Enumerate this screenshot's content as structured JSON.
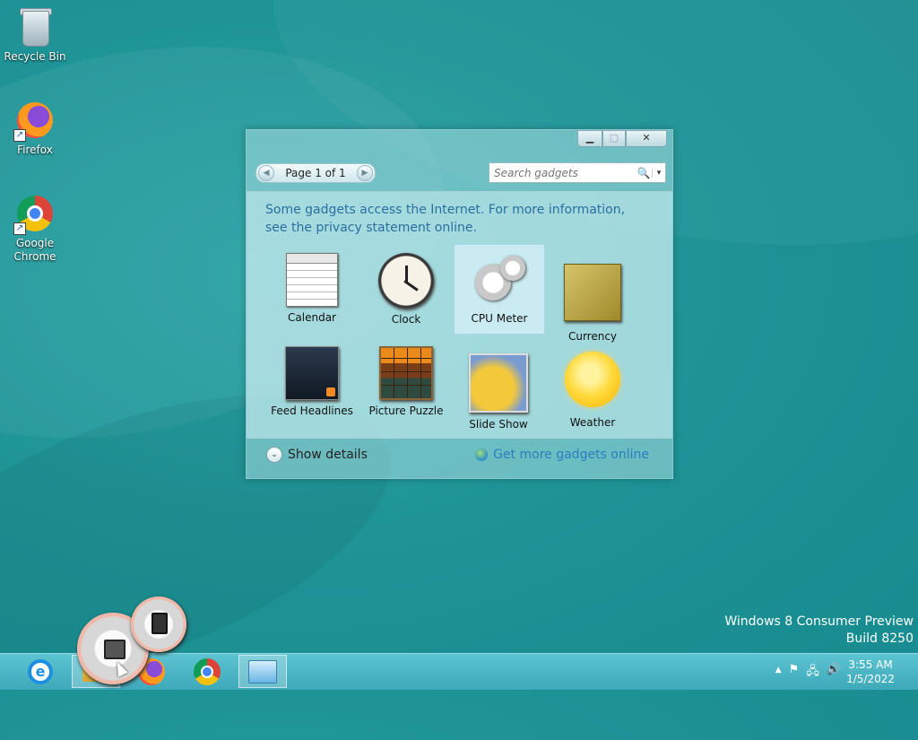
{
  "desktop": {
    "icons": [
      {
        "label": "Recycle Bin",
        "icon": "recycle-bin-icon"
      },
      {
        "label": "Firefox",
        "icon": "firefox-icon"
      },
      {
        "label": "Google Chrome",
        "icon": "chrome-icon"
      }
    ],
    "watermark": {
      "line1": "Windows 8 Consumer Preview",
      "line2": "Build 8250"
    }
  },
  "gadget_window": {
    "caption_buttons": {
      "minimize": "▁",
      "maximize": "▢",
      "close": "✕"
    },
    "pager": {
      "prev": "◀",
      "label": "Page 1 of 1",
      "next": "▶"
    },
    "search": {
      "placeholder": "Search gadgets",
      "icon": "🔍",
      "dropdown": "▾"
    },
    "notice": "Some gadgets access the Internet.  For more information, see the privacy statement online.",
    "gadgets": [
      {
        "label": "Calendar",
        "icon": "calendar-icon"
      },
      {
        "label": "Clock",
        "icon": "clock-icon"
      },
      {
        "label": "CPU Meter",
        "icon": "cpu-meter-icon",
        "selected": true
      },
      {
        "label": "Currency",
        "icon": "currency-icon"
      },
      {
        "label": "Feed Headlines",
        "icon": "feed-headlines-icon"
      },
      {
        "label": "Picture Puzzle",
        "icon": "picture-puzzle-icon"
      },
      {
        "label": "Slide Show",
        "icon": "slide-show-icon"
      },
      {
        "label": "Weather",
        "icon": "weather-icon"
      }
    ],
    "footer": {
      "show_details": "Show details",
      "chevron": "⌄",
      "get_more": "Get more gadgets online"
    }
  },
  "taskbar": {
    "apps": [
      "internet-explorer-icon",
      "file-explorer-icon",
      "firefox-icon",
      "chrome-icon",
      "gadgets-icon"
    ],
    "tray": {
      "show_hidden": "▲",
      "flag": "⚑",
      "network": "🖧",
      "volume": "🔊"
    },
    "clock": {
      "time": "3:55 AM",
      "date": "1/5/2022"
    }
  }
}
